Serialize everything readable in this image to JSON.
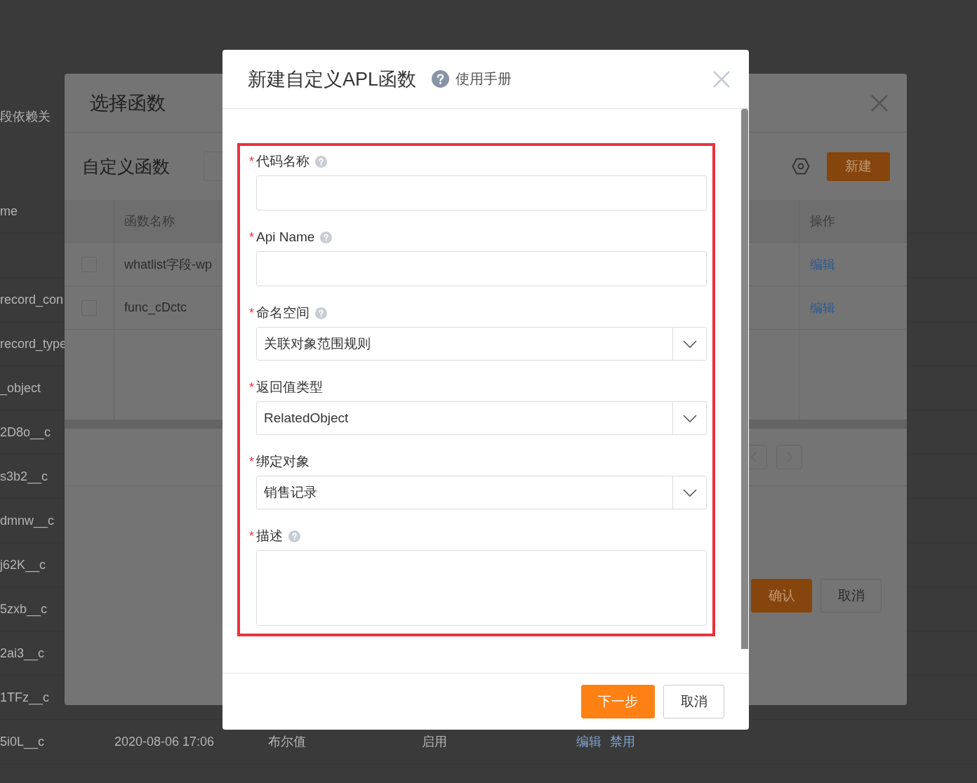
{
  "background_page": {
    "tab_text": "段依赖关",
    "column_header": "me",
    "first_column": [
      "record_con",
      "record_type",
      "_object",
      "2D8o__c",
      "s3b2__c",
      "dmnw__c",
      "j62K__c",
      "5zxb__c",
      "2ai3__c",
      "1TFz__c"
    ],
    "last_row": {
      "cells": [
        "5i0L__c",
        "2020-08-06 17:06",
        "布尔值",
        "启用"
      ],
      "actions": [
        "编辑",
        "禁用"
      ]
    }
  },
  "select_function_dialog": {
    "title": "选择函数",
    "section_title": "自定义函数",
    "new_button": "新建",
    "columns": [
      "函数名称",
      "操作"
    ],
    "rows": [
      {
        "name": "whatlist字段-wp",
        "checked": false,
        "action": "编辑"
      },
      {
        "name": "func_cDctc",
        "checked": false,
        "action": "编辑"
      }
    ],
    "buttons": [
      "确认",
      "取消"
    ]
  },
  "new_function_dialog": {
    "title": "新建自定义APL函数",
    "help_link": "使用手册",
    "fields": [
      {
        "kind": "text",
        "label": "代码名称",
        "required_mark": "*",
        "help": true
      },
      {
        "kind": "text",
        "label": "Api Name",
        "required_mark": "*",
        "help": true
      },
      {
        "kind": "select",
        "label": "命名空间",
        "required_mark": "*",
        "help": true,
        "value": "关联对象范围规则"
      },
      {
        "kind": "select",
        "label": "返回值类型",
        "required_mark": "*",
        "help": false,
        "value": "RelatedObject"
      },
      {
        "kind": "select",
        "label": "绑定对象",
        "required_mark": "*",
        "help": false,
        "value": "销售记录"
      },
      {
        "kind": "textarea",
        "label": "描述",
        "required_mark": "*",
        "help": true
      }
    ],
    "buttons": [
      {
        "label": "下一步",
        "primary": true
      },
      {
        "label": "取消",
        "primary": false
      }
    ]
  }
}
